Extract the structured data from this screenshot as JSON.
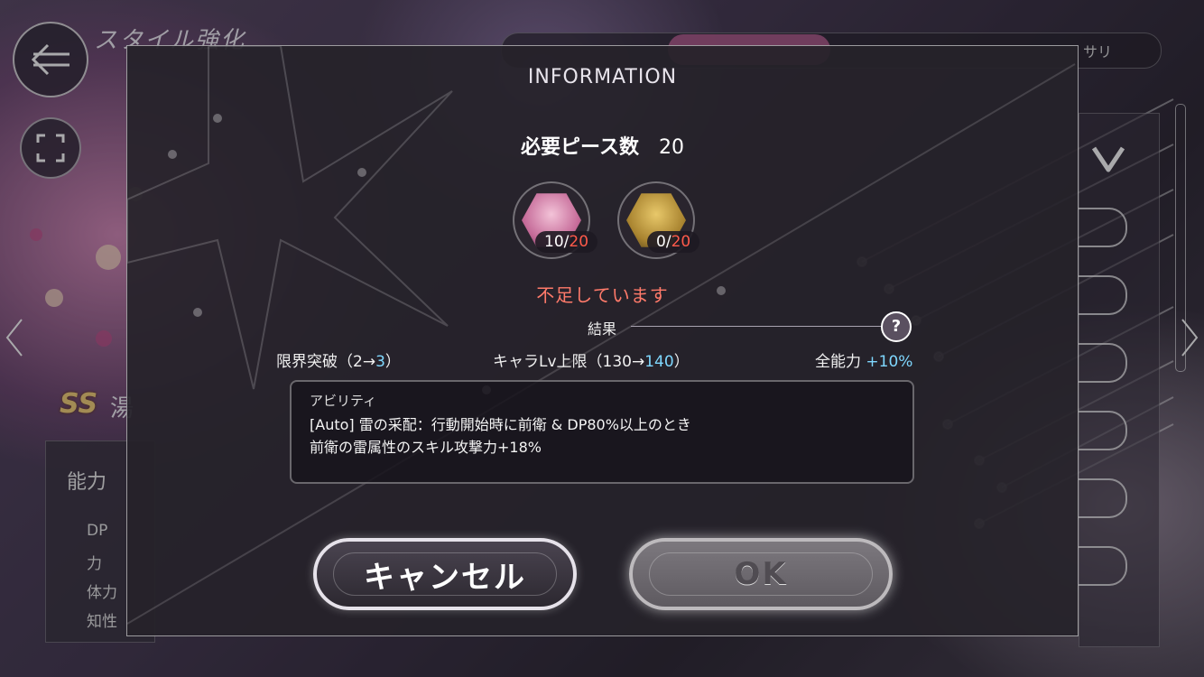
{
  "screen": {
    "title": "スタイル強化",
    "tab_partial": "サリ"
  },
  "left_panel": {
    "badge": "SS",
    "char_partial": "湯",
    "title": "能力",
    "stats": [
      "DP",
      "力",
      "体力",
      "知性"
    ]
  },
  "dialog": {
    "title": "INFORMATION",
    "required_label": "必要ピース数",
    "required_value": "20",
    "items": [
      {
        "have": "10",
        "sep": "/",
        "need": "20",
        "icon": "character-piece-icon"
      },
      {
        "have": "0",
        "sep": "/",
        "need": "20",
        "icon": "gold-piece-icon"
      }
    ],
    "warning": "不足しています",
    "result_label": "結果",
    "help": "?",
    "results": [
      {
        "prefix": "限界突破（2→",
        "value": "3",
        "suffix": "）"
      },
      {
        "prefix": "キャラLv上限（130→",
        "value": "140",
        "suffix": "）"
      },
      {
        "prefix": "全能力 ",
        "value": "+10%",
        "suffix": ""
      }
    ],
    "ability": {
      "heading": "アビリティ",
      "line1": "[Auto] 雷の采配：行動開始時に前衛 & DP80%以上のとき",
      "line2": "前衛の雷属性のスキル攻撃力+18%"
    },
    "cancel_label": "キャンセル",
    "ok_label": "OK"
  },
  "colors": {
    "accent_red": "#ff5a4a",
    "accent_cyan": "#7fd8ff",
    "warning": "#ff7a6a"
  }
}
